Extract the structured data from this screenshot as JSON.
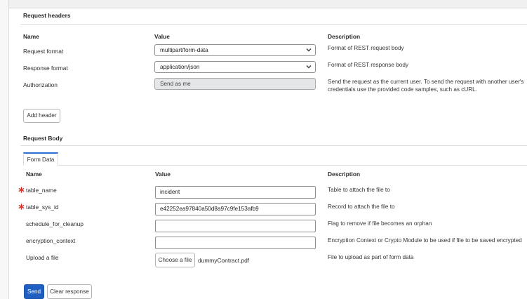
{
  "request_headers": {
    "title": "Request headers",
    "columns": {
      "name": "Name",
      "value": "Value",
      "description": "Description"
    },
    "rows": [
      {
        "name": "Request format",
        "value": "multipart/form-data",
        "description": "Format of REST request body"
      },
      {
        "name": "Response format",
        "value": "application/json",
        "description": "Format of REST response body"
      },
      {
        "name": "Authorization",
        "value": "Send as me",
        "description": "Send the request as the current user. To send the request with another user's credentials use the provided code samples, such as cURL."
      }
    ],
    "add_header_label": "Add header"
  },
  "request_body": {
    "title": "Request Body",
    "tab_label": "Form Data",
    "columns": {
      "name": "Name",
      "value": "Value",
      "description": "Description"
    },
    "fields": [
      {
        "name": "table_name",
        "value": "incident",
        "description": "Table to attach the file to",
        "required": true
      },
      {
        "name": "table_sys_id",
        "value": "e42252ea97840a50d8a97c9fe153afb9",
        "description": "Record to attach the file to",
        "required": true
      },
      {
        "name": "schedule_for_cleanup",
        "value": "",
        "description": "Flag to remove if file becomes an orphan",
        "required": false
      },
      {
        "name": "encryption_context",
        "value": "",
        "description": "Encryption Context or Crypto Module to be used if file to be saved encrypted",
        "required": false
      }
    ],
    "upload": {
      "name": "Upload a file",
      "button_label": "Choose a file",
      "file_name": "dummyContract.pdf",
      "description": "File to upload as part of form data"
    }
  },
  "actions": {
    "send_label": "Send",
    "clear_label": "Clear response"
  },
  "colors": {
    "primary": "#1f5fc2",
    "required": "#d9352b",
    "tab_accent": "#2c6fd6"
  }
}
